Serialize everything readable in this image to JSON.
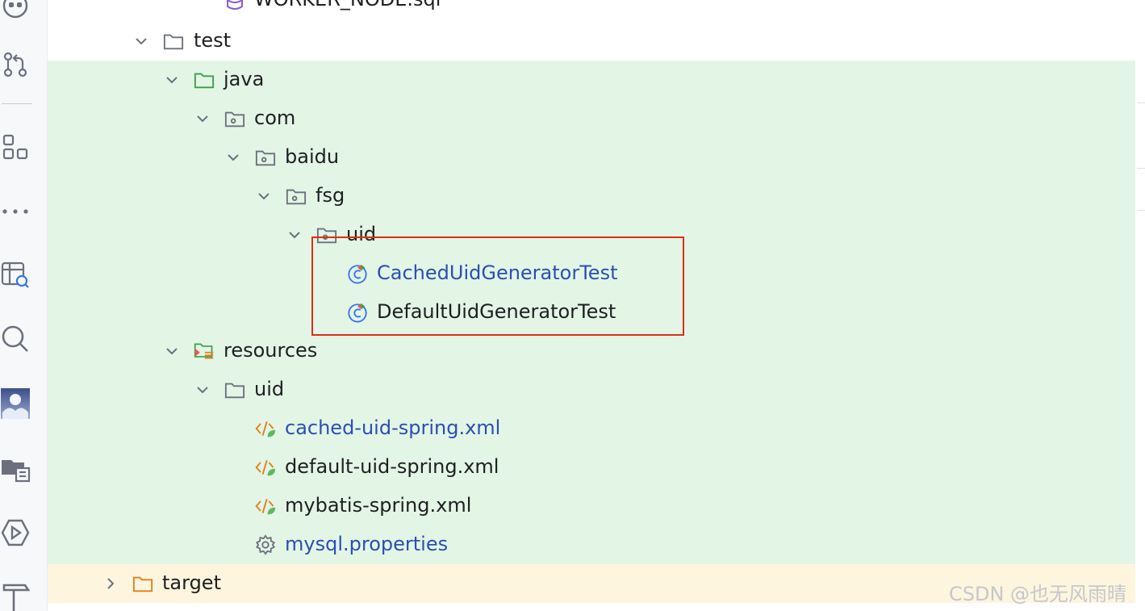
{
  "tree": {
    "top_item": {
      "label": "WORKER_NODE.sql",
      "icon": "database-file-icon"
    },
    "rows": [
      {
        "id": "test",
        "label": "test",
        "icon": "folder-icon",
        "expanded": true
      },
      {
        "id": "java",
        "label": "java",
        "icon": "test-source-folder-icon",
        "expanded": true
      },
      {
        "id": "com",
        "label": "com",
        "icon": "package-icon",
        "expanded": true
      },
      {
        "id": "baidu",
        "label": "baidu",
        "icon": "package-icon",
        "expanded": true
      },
      {
        "id": "fsg",
        "label": "fsg",
        "icon": "package-icon",
        "expanded": true
      },
      {
        "id": "uid-package",
        "label": "uid",
        "icon": "package-icon",
        "expanded": true
      },
      {
        "id": "cached-test",
        "label": "CachedUidGeneratorTest",
        "icon": "test-class-icon"
      },
      {
        "id": "default-test",
        "label": "DefaultUidGeneratorTest",
        "icon": "test-class-icon"
      },
      {
        "id": "resources",
        "label": "resources",
        "icon": "test-resources-folder-icon",
        "expanded": true
      },
      {
        "id": "uid-folder",
        "label": "uid",
        "icon": "folder-icon",
        "expanded": true
      },
      {
        "id": "cached-xml",
        "label": "cached-uid-spring.xml",
        "icon": "spring-xml-icon"
      },
      {
        "id": "default-xml",
        "label": "default-uid-spring.xml",
        "icon": "spring-xml-icon"
      },
      {
        "id": "mybatis-xml",
        "label": "mybatis-spring.xml",
        "icon": "spring-xml-icon"
      },
      {
        "id": "mysql-props",
        "label": "mysql.properties",
        "icon": "properties-gear-icon"
      },
      {
        "id": "target",
        "label": "target",
        "icon": "excluded-folder-icon",
        "expanded": false
      }
    ]
  },
  "watermark": "CSDN @也无风雨晴",
  "colors": {
    "test_row_bg": "#e3f5e5",
    "excluded_row_bg": "#fdf5de",
    "modified_label": "#2b4fb3",
    "highlight_box": "#e02d1a"
  }
}
